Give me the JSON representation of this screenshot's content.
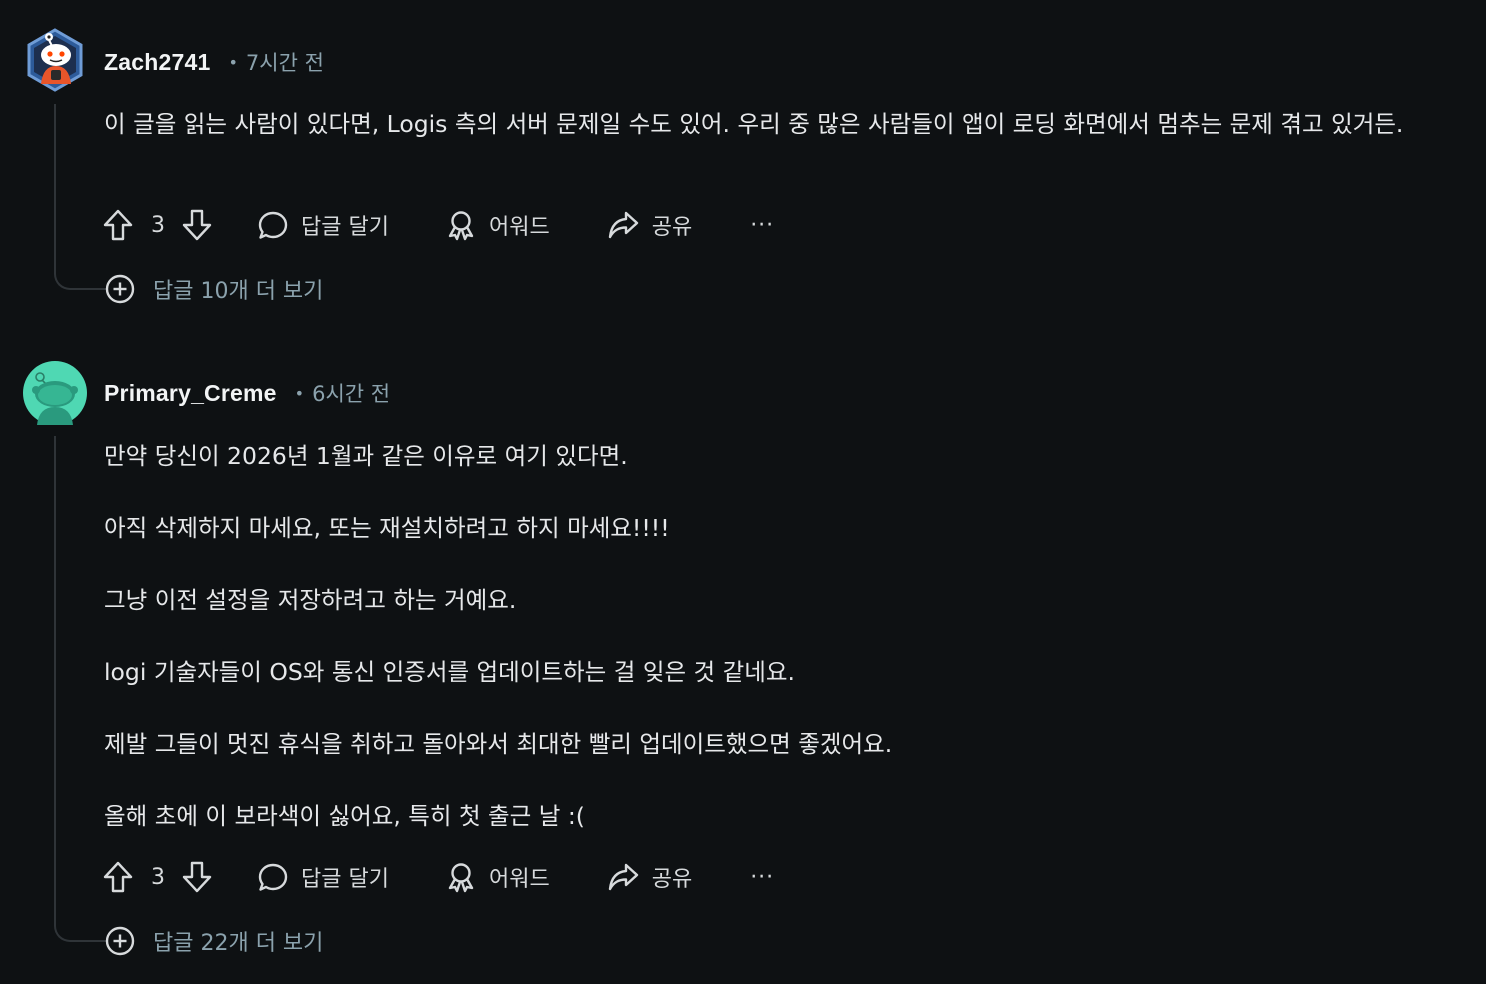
{
  "comments": [
    {
      "username": "Zach2741",
      "time": "7시간 전",
      "body": [
        "이 글을 읽는 사람이 있다면, Logis 측의 서버 문제일 수도 있어. 우리 중 많은 사람들이 앱이 로딩 화면에서 멈추는 문제 겪고 있거든."
      ],
      "votes": "3",
      "reply_label": "답글 달기",
      "award_label": "어워드",
      "share_label": "공유",
      "more_label": "···",
      "more_replies": "답글 10개 더 보기"
    },
    {
      "username": "Primary_Creme",
      "time": "6시간 전",
      "body": [
        "만약 당신이 2026년 1월과 같은 이유로 여기 있다면.",
        "아직 삭제하지 마세요, 또는 재설치하려고 하지 마세요!!!!",
        "그냥 이전 설정을 저장하려고 하는 거예요.",
        "logi 기술자들이 OS와 통신 인증서를 업데이트하는 걸 잊은 것 같네요.",
        "제발 그들이 멋진 휴식을 취하고 돌아와서 최대한 빨리 업데이트했으면 좋겠어요.",
        "올해 초에 이 보라색이 싫어요, 특히 첫 출근 날 :("
      ],
      "votes": "3",
      "reply_label": "답글 달기",
      "award_label": "어워드",
      "share_label": "공유",
      "more_label": "···",
      "more_replies": "답글 22개 더 보기"
    }
  ],
  "colors": {
    "background": "#0e1113",
    "text": "#e6e8ea",
    "meta": "#8ba2ad",
    "thread_line": "#2f3438"
  }
}
